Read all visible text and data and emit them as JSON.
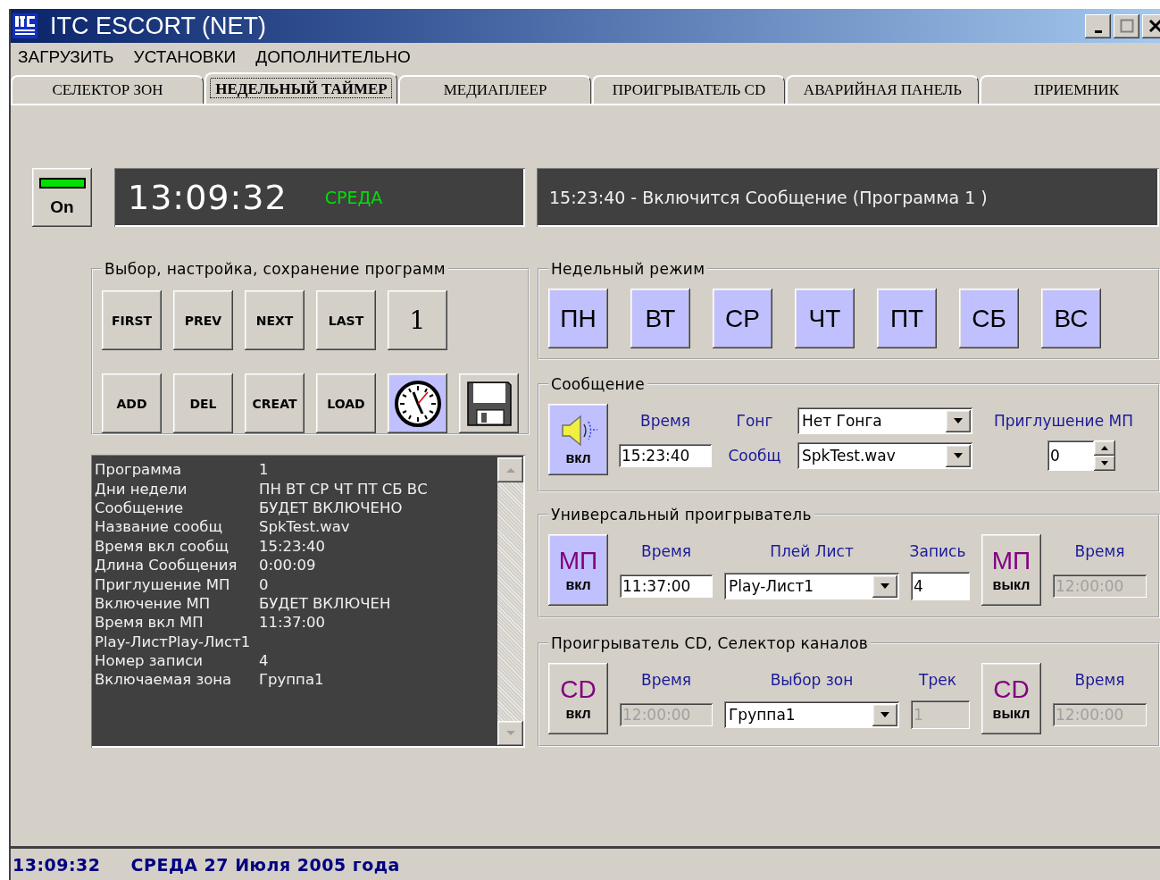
{
  "window": {
    "title": "ITC ESCORT (NET)"
  },
  "menu": [
    "ЗАГРУЗИТЬ",
    "УСТАНОВКИ",
    "ДОПОЛНИТЕЛЬНО"
  ],
  "tabs": [
    {
      "label": "СЕЛЕКТОР ЗОН",
      "selected": false
    },
    {
      "label": "НЕДЕЛЬНЫЙ ТАЙМЕР",
      "selected": true
    },
    {
      "label": "МЕДИАПЛЕЕР",
      "selected": false
    },
    {
      "label": "ПРОИГРЫВАТЕЛЬ CD",
      "selected": false
    },
    {
      "label": "АВАРИЙНАЯ ПАНЕЛЬ",
      "selected": false
    },
    {
      "label": "ПРИЕМНИК",
      "selected": false
    }
  ],
  "power": {
    "label": "On",
    "on": true
  },
  "clock": {
    "time": "13:09:32",
    "day": "СРЕДА"
  },
  "next_event": "15:23:40 - Включится Сообщение (Программа 1 )",
  "programs": {
    "title": "Выбор, настройка, сохранение программ",
    "nav_buttons": [
      "FIRST",
      "PREV",
      "NEXT",
      "LAST"
    ],
    "counter": "1",
    "action_buttons": [
      "ADD",
      "DEL",
      "CREAT",
      "LOAD"
    ],
    "tool_buttons": [
      {
        "kind": "clock",
        "active": true
      },
      {
        "kind": "save",
        "active": false
      }
    ]
  },
  "program_info": [
    {
      "label": "Программа",
      "value": "1"
    },
    {
      "label": "Дни недели",
      "value": "ПН ВТ СР ЧТ ПТ СБ ВС"
    },
    {
      "label": "Сообщение",
      "value": "БУДЕТ ВКЛЮЧЕНО"
    },
    {
      "label": "Название сообщ",
      "value": "SpkTest.wav"
    },
    {
      "label": "Время вкл сообщ",
      "value": "15:23:40"
    },
    {
      "label": "Длина Сообщения",
      "value": "0:00:09"
    },
    {
      "label": "Приглушение МП",
      "value": "0"
    },
    {
      "label": "Включение МП",
      "value": "БУДЕТ ВКЛЮЧЕН"
    },
    {
      "label": "Время вкл МП",
      "value": "11:37:00"
    },
    {
      "label": "Play-ЛистPlay-Лист1"
    },
    {
      "label": "Номер записи",
      "value": "4"
    },
    {
      "label": "Включаемая зона",
      "value": "Группа1"
    }
  ],
  "weekly": {
    "title": "Недельный режим",
    "days": [
      {
        "label": "ПН",
        "selected": true
      },
      {
        "label": "ВТ",
        "selected": true
      },
      {
        "label": "СР",
        "selected": true
      },
      {
        "label": "ЧТ",
        "selected": true
      },
      {
        "label": "ПТ",
        "selected": true
      },
      {
        "label": "СБ",
        "selected": true
      },
      {
        "label": "ВС",
        "selected": true
      }
    ]
  },
  "message": {
    "title": "Сообщение",
    "button": {
      "label": "вкл",
      "active": true
    },
    "time": {
      "label": "Время",
      "value": "15:23:40"
    },
    "gong": {
      "label": "Гонг",
      "value": "Нет Гонга"
    },
    "file": {
      "label": "Сообщ",
      "value": "SpkTest.wav"
    },
    "mute": {
      "label": "Приглушение МП",
      "value": "0"
    }
  },
  "players": [
    {
      "title": "Универсальный проигрыватель",
      "start_button": {
        "icon_text": "МП",
        "label": "вкл",
        "active": true
      },
      "start_time": {
        "label": "Время",
        "value": "11:37:00",
        "disabled": false
      },
      "selector": {
        "label": "Плей Лист",
        "value": "Play-Лист1"
      },
      "number": {
        "label": "Запись",
        "value": "4",
        "disabled": false
      },
      "stop_button": {
        "icon_text": "МП",
        "label": "выкл",
        "active": false
      },
      "stop_time": {
        "label": "Время",
        "value": "12:00:00",
        "disabled": true
      }
    },
    {
      "title": "Проигрыватель CD,  Селектор каналов",
      "start_button": {
        "icon_text": "CD",
        "label": "вкл",
        "active": false
      },
      "start_time": {
        "label": "Время",
        "value": "12:00:00",
        "disabled": true
      },
      "selector": {
        "label": "Выбор зон",
        "value": "Группа1"
      },
      "number": {
        "label": "Трек",
        "value": "1",
        "disabled": true
      },
      "stop_button": {
        "icon_text": "CD",
        "label": "выкл",
        "active": false
      },
      "stop_time": {
        "label": "Время",
        "value": "12:00:00",
        "disabled": true
      }
    }
  ],
  "status_bar": {
    "time": "13:09:32",
    "date": "СРЕДА 27 Июля 2005 года"
  }
}
